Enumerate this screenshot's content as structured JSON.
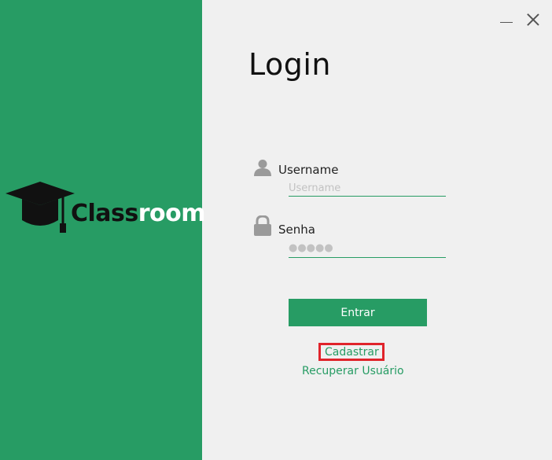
{
  "app": {
    "logo_text_dark": "Class",
    "logo_text_light": "room",
    "brand_color": "#279c64"
  },
  "window_controls": {
    "minimize_icon": "minimize-icon",
    "close_icon": "close-icon"
  },
  "login": {
    "title": "Login",
    "username": {
      "label": "Username",
      "placeholder": "Username",
      "value": "",
      "icon": "user-icon"
    },
    "password": {
      "label": "Senha",
      "masked_value": "●●●●●",
      "icon": "lock-icon"
    },
    "enter_button": "Entrar",
    "register_link": "Cadastrar",
    "recover_link": "Recuperar Usuário",
    "highlight_color": "#e0242b"
  }
}
